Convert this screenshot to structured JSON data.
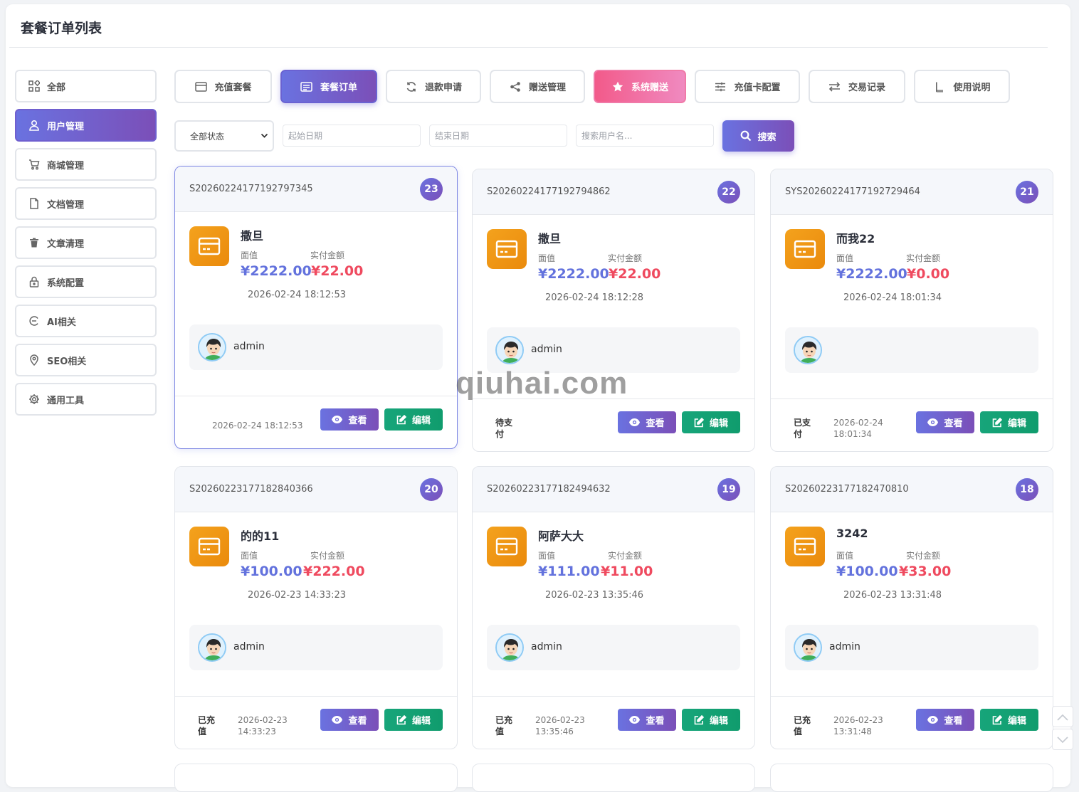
{
  "page": {
    "title": "套餐订单列表"
  },
  "sidebar": {
    "items": [
      {
        "label": "全部",
        "icon": "grid-icon"
      },
      {
        "label": "用户管理",
        "icon": "user-icon",
        "active": true
      },
      {
        "label": "商城管理",
        "icon": "cart-icon"
      },
      {
        "label": "文档管理",
        "icon": "file-icon"
      },
      {
        "label": "文章清理",
        "icon": "trash-icon"
      },
      {
        "label": "系统配置",
        "icon": "lock-icon"
      },
      {
        "label": "AI相关",
        "icon": "ai-icon"
      },
      {
        "label": "SEO相关",
        "icon": "location-icon"
      },
      {
        "label": "通用工具",
        "icon": "gear-icon"
      }
    ]
  },
  "tabs": [
    {
      "label": "充值套餐",
      "icon": "card-icon"
    },
    {
      "label": "套餐订单",
      "icon": "list-icon",
      "active": true
    },
    {
      "label": "退款申请",
      "icon": "refresh-icon"
    },
    {
      "label": "赠送管理",
      "icon": "share-icon"
    },
    {
      "label": "系统赠送",
      "icon": "star-icon"
    },
    {
      "label": "充值卡配置",
      "icon": "sliders-icon"
    },
    {
      "label": "交易记录",
      "icon": "exchange-icon"
    },
    {
      "label": "使用说明",
      "icon": "book-icon"
    }
  ],
  "filters": {
    "status_value": "全部状态",
    "start_placeholder": "起始日期",
    "end_placeholder": "结束日期",
    "user_placeholder": "搜索用户名...",
    "search_label": "搜索"
  },
  "card_labels": {
    "face": "面值",
    "paid": "实付金额",
    "view": "查看",
    "edit": "编辑"
  },
  "orders": [
    {
      "no": "S20260224177192797345",
      "badge": "23",
      "name": "撒旦",
      "face": "¥2222.00",
      "paid": "¥22.00",
      "created": "2026-02-24 18:12:53",
      "user": "admin",
      "status": "",
      "footer_time": "2026-02-24 18:12:53"
    },
    {
      "no": "S20260224177192794862",
      "badge": "22",
      "name": "撒旦",
      "face": "¥2222.00",
      "paid": "¥22.00",
      "created": "2026-02-24 18:12:28",
      "user": "admin",
      "status": "待支付",
      "footer_time": ""
    },
    {
      "no": "SYS20260224177192729464",
      "badge": "21",
      "name": "而我22",
      "face": "¥2222.00",
      "paid": "¥0.00",
      "created": "2026-02-24 18:01:34",
      "user": "",
      "status": "已支付",
      "footer_time": "2026-02-24 18:01:34"
    },
    {
      "no": "S20260223177182840366",
      "badge": "20",
      "name": "的的11",
      "face": "¥100.00",
      "paid": "¥222.00",
      "created": "2026-02-23 14:33:23",
      "user": "admin",
      "status": "已充值",
      "footer_time": "2026-02-23 14:33:23"
    },
    {
      "no": "S20260223177182494632",
      "badge": "19",
      "name": "阿萨大大",
      "face": "¥111.00",
      "paid": "¥11.00",
      "created": "2026-02-23 13:35:46",
      "user": "admin",
      "status": "已充值",
      "footer_time": "2026-02-23 13:35:46"
    },
    {
      "no": "S20260223177182470810",
      "badge": "18",
      "name": "3242",
      "face": "¥100.00",
      "paid": "¥33.00",
      "created": "2026-02-23 13:31:48",
      "user": "admin",
      "status": "已充值",
      "footer_time": "2026-02-23 13:31:48"
    }
  ],
  "watermark": "qiuhai.com",
  "colors": {
    "accent": "#6a72e0",
    "accent_dark": "#7b4fb8",
    "pink": "#f25a8a",
    "green": "#17a57a",
    "orange": "#f4a21d",
    "price_red": "#ef4a5f",
    "price_blue": "#6372dd"
  }
}
